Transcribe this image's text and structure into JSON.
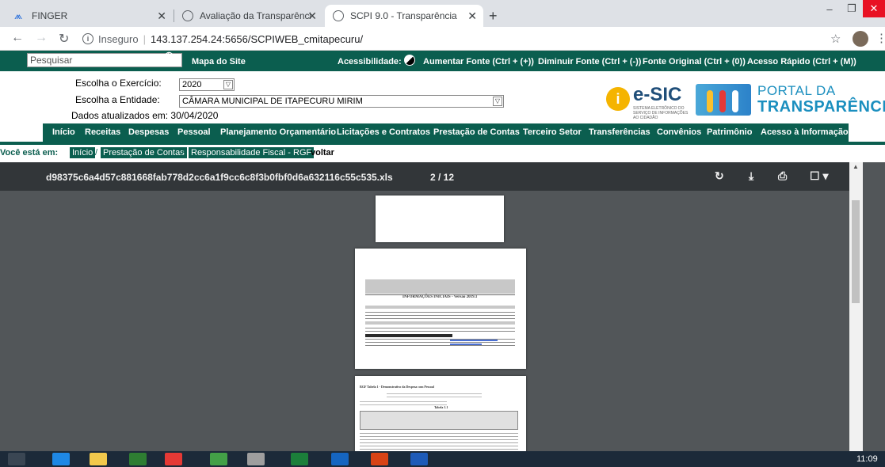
{
  "browser": {
    "tabs": [
      {
        "title": "FINGER",
        "active": false
      },
      {
        "title": "Avaliação da Transparência dos Í",
        "active": false
      },
      {
        "title": "SCPI 9.0 - Transparência",
        "active": true
      }
    ],
    "address": {
      "security_label": "Inseguro",
      "url": "143.137.254.24:5656/SCPIWEB_cmitapecuru/"
    }
  },
  "topbar": {
    "search_placeholder": "Pesquisar",
    "site_map": "Mapa do Site",
    "accessibility_label": "Acessibilidade:",
    "increase_font": "Aumentar Fonte (Ctrl + (+))",
    "decrease_font": "Diminuir Fonte (Ctrl + (-))",
    "original_font": "Fonte Original (Ctrl + (0))",
    "quick_access": "Acesso Rápido (Ctrl + (M))"
  },
  "filters": {
    "exercise_label": "Escolha o Exercício:",
    "exercise_value": "2020",
    "entity_label": "Escolha a Entidade:",
    "entity_value": "CÂMARA MUNICIPAL DE ITAPECURU MIRIM",
    "updated_text": "Dados atualizados em: 30/04/2020"
  },
  "logos": {
    "esic_text": "e-SIC",
    "esic_sub": "SISTEMA ELETRÔNICO DO SERVIÇO DE INFORMAÇÕES AO CIDADÃO",
    "portal_line1": "PORTAL DA",
    "portal_line2": "TRANSPARÊNCIA"
  },
  "main_nav": [
    "Início",
    "Receitas",
    "Despesas",
    "Pessoal",
    "Planejamento Orçamentário",
    "Licitações e Contratos",
    "Prestação de Contas",
    "Terceiro Setor",
    "Transferências",
    "Convênios",
    "Patrimônio",
    "Acesso à Informação"
  ],
  "breadcrumb": {
    "label": "Você está em:",
    "items": [
      "Início",
      "Prestação de Contas",
      "Responsabilidade Fiscal - RGF"
    ],
    "back": "voltar"
  },
  "viewer": {
    "filename": "d98375c6a4d57c881668fab778d2cc6a1f9cc6c8f3b0fbf0d6a632116c55c535.xls",
    "page_indicator": "2 / 12",
    "page2_heading": "INFORMAÇÕES INICIAIS - Versão 2019.1",
    "page3_heading": "RGF Tabela 1 - Demonstrativo da Despesa com Pessoal",
    "page3_table_label": "Tabela 1.1"
  },
  "taskbar": {
    "clock": "11:09"
  },
  "colors": {
    "brand_green": "#0b5e4f",
    "viewer_bg": "#525659",
    "viewer_bar": "#323639"
  }
}
